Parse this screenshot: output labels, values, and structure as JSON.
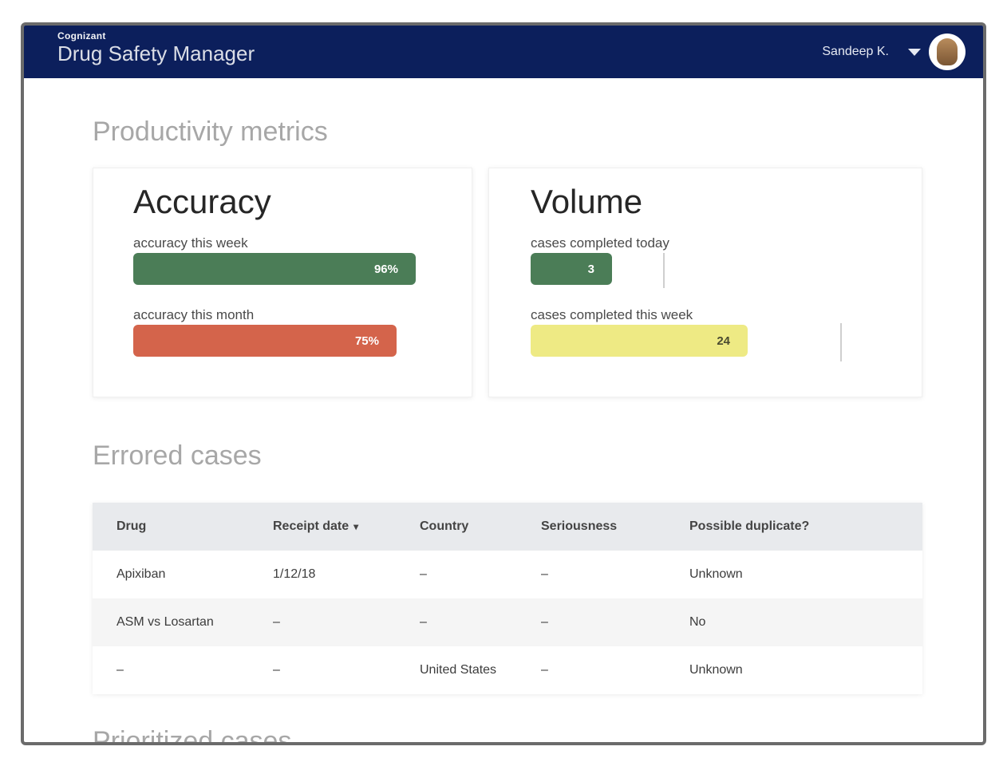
{
  "app": {
    "brand_small": "Cognizant",
    "title": "Drug Safety Manager",
    "user_name": "Sandeep K."
  },
  "productivity": {
    "title": "Productivity metrics",
    "accuracy": {
      "title": "Accuracy",
      "week_label": "accuracy this week",
      "week_value": "96%",
      "week_fraction": 0.96,
      "month_label": "accuracy this month",
      "month_value": "75%",
      "month_fraction": 0.75
    },
    "volume": {
      "title": "Volume",
      "today_label": "cases completed today",
      "today_value": "3",
      "week_label": "cases completed this week",
      "week_value": "24"
    }
  },
  "errored": {
    "title": "Errored cases",
    "columns": [
      "Drug",
      "Receipt date",
      "Country",
      "Seriousness",
      "Possible duplicate?"
    ],
    "sort_arrow": "▾",
    "rows": [
      [
        "Apixiban",
        "1/12/18",
        "–",
        "–",
        "Unknown"
      ],
      [
        "ASM vs Losartan",
        "–",
        "–",
        "–",
        "No"
      ],
      [
        "–",
        "–",
        "United States",
        "–",
        "Unknown"
      ]
    ]
  },
  "next_section": {
    "title": "Prioritized cases"
  },
  "colors": {
    "header": "#0c1f5c",
    "good": "#4b7d57",
    "bad": "#d4644b",
    "warn": "#eeea84"
  }
}
